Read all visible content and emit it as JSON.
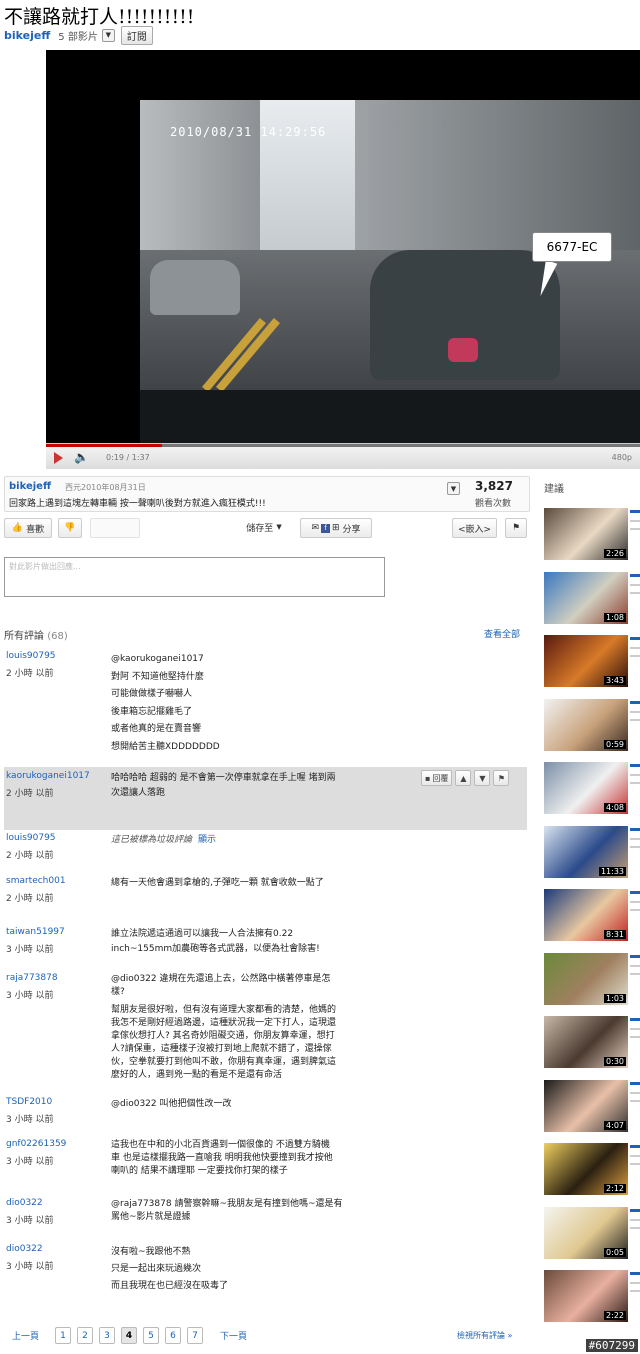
{
  "page": {
    "title": "不讓路就打人!!!!!!!!!!"
  },
  "channel": {
    "name": "bikejeff",
    "video_count": "5 部影片",
    "subscribe": "訂閱"
  },
  "player": {
    "timestamp_overlay": "2010/08/31  14:29:56",
    "plate_callout": "6677-EC",
    "time_display": "0:19 / 1:37",
    "quality": "480p",
    "progress": 0.196
  },
  "info": {
    "author": "bikejeff",
    "date": "西元2010年08月31日",
    "description": "回家路上遇到這塊左轉車輛 按一聲喇叭後對方就進入瘋狂模式!!!",
    "views": "3,827",
    "views_label": "觀看次數"
  },
  "actions": {
    "like": "喜歡",
    "save": "儲存至",
    "share": "分享",
    "embed": "<嵌入>"
  },
  "comment_input": {
    "placeholder": "對此影片做出回應..."
  },
  "comments_section": {
    "title": "所有評論",
    "count": "(68)",
    "view_all": "查看全部",
    "comments": [
      {
        "author": "louis90795",
        "time": "2 小時 以前",
        "lines": [
          "@kaorukoganei1017",
          "對阿 不知道他堅持什麼",
          "可能做做樣子嚇嚇人",
          "後車箱忘記擺雞毛了",
          "或者他真的是在賣音響",
          "想開給苦主聽XDDDDDDD"
        ]
      },
      {
        "author": "kaorukoganei1017",
        "time": "2 小時 以前",
        "lines": [
          "哈哈哈哈 超弱的 是不會第一次停車就拿在手上喔 堵到兩",
          "次還讓人落跑"
        ],
        "reply": "回覆"
      },
      {
        "author": "louis90795",
        "time": "2 小時 以前",
        "spam": "這已被標為垃圾評論",
        "show": "顯示"
      },
      {
        "author": "smartech001",
        "time": "2 小時 以前",
        "lines": [
          "總有一天他會遇到拿槍的,子彈吃一顆    就會收斂一點了"
        ]
      },
      {
        "author": "taiwan51997",
        "time": "3 小時 以前",
        "lines": [
          "誰立法院遞這通過可以讓我一人合法擁有0.22",
          "inch~155mm加農砲等各式武器，以便為社會除害!"
        ]
      },
      {
        "author": "raja773878",
        "time": "3 小時 以前",
        "lines": [
          "@dio0322 違規在先還追上去，公然路中橫著停車是怎",
          "樣?",
          "",
          "幫朋友是很好啦，但有沒有道理大家都看的清楚，他媽的",
          "我怎不是剛好經過路邊，這種狀況我一定下打人，這現還",
          "拿傢伙想打人? 其名奇妙阻礙交通，你朋友算幸運，想打",
          "人?請保重，這種樣子沒被打到地上爬就不錯了，還操傢",
          "伙，空拳就要打到他叫不敢，你朋有真幸運，遇到脾氣這",
          "麼好的人，遇到兇一點的看是不是還有命活"
        ]
      },
      {
        "author": "TSDF2010",
        "time": "3 小時 以前",
        "lines": [
          "@dio0322 叫他把個性改一改"
        ]
      },
      {
        "author": "gnf02261359",
        "time": "3 小時 以前",
        "lines": [
          "這我也在中和的小北百貨遇到一個很像的 不過雙方騎機",
          "車 也是這樣擺我路一直嗆我 明明我他快要撞到我才按他",
          "喇叭的 結果不講理耶 一定要找你打架的樣子"
        ]
      },
      {
        "author": "dio0322",
        "time": "3 小時 以前",
        "lines": [
          "@raja773878 請警察幹嘛~我朋友是有撞到他嗎~還是有",
          "罵他~影片就是證據"
        ]
      },
      {
        "author": "dio0322",
        "time": "3 小時 以前",
        "lines": [
          "沒有啦~我跟他不熟",
          "只是一起出來玩過幾次",
          "而且我現在也已經沒在吸毒了"
        ]
      }
    ]
  },
  "pagination": {
    "prev": "上一頁",
    "pages": [
      "1",
      "2",
      "3",
      "4",
      "5",
      "6",
      "7"
    ],
    "current": "4",
    "next": "下一頁",
    "view_all": "檢視所有評論 »"
  },
  "sidebar": {
    "title": "建議",
    "items": [
      {
        "duration": "2:26",
        "colors": [
          "#5a4a3c",
          "#e9d9c4",
          "#2b2b2b"
        ]
      },
      {
        "duration": "1:08",
        "colors": [
          "#3a78c0",
          "#d1cfc0",
          "#8a3b2b"
        ]
      },
      {
        "duration": "3:43",
        "colors": [
          "#5a1a10",
          "#d87a28",
          "#2a0e08"
        ]
      },
      {
        "duration": "0:59",
        "colors": [
          "#f2f2f2",
          "#c9a27c",
          "#3a2a20"
        ]
      },
      {
        "duration": "4:08",
        "colors": [
          "#7b8fa8",
          "#f0f0f0",
          "#c23030"
        ]
      },
      {
        "duration": "11:33",
        "colors": [
          "#d9e4f0",
          "#2a4a8a",
          "#c8a070"
        ]
      },
      {
        "duration": "8:31",
        "colors": [
          "#1a3a7a",
          "#e8c8a0",
          "#c02020"
        ]
      },
      {
        "duration": "1:03",
        "colors": [
          "#6b8a3a",
          "#a08060",
          "#e0e0d0"
        ]
      },
      {
        "duration": "0:30",
        "colors": [
          "#c8b8a8",
          "#4a3a30",
          "#e8d0c0"
        ]
      },
      {
        "duration": "4:07",
        "colors": [
          "#1a1a1a",
          "#e8c0a8",
          "#303030"
        ]
      },
      {
        "duration": "2:12",
        "colors": [
          "#f0d060",
          "#2a2010",
          "#e0a040"
        ]
      },
      {
        "duration": "0:05",
        "colors": [
          "#f4f4f0",
          "#e0c890",
          "#202020"
        ]
      },
      {
        "duration": "2:22",
        "colors": [
          "#6a4a3a",
          "#e8b0a0",
          "#2a1a14"
        ]
      }
    ]
  },
  "watermark": "#607299"
}
